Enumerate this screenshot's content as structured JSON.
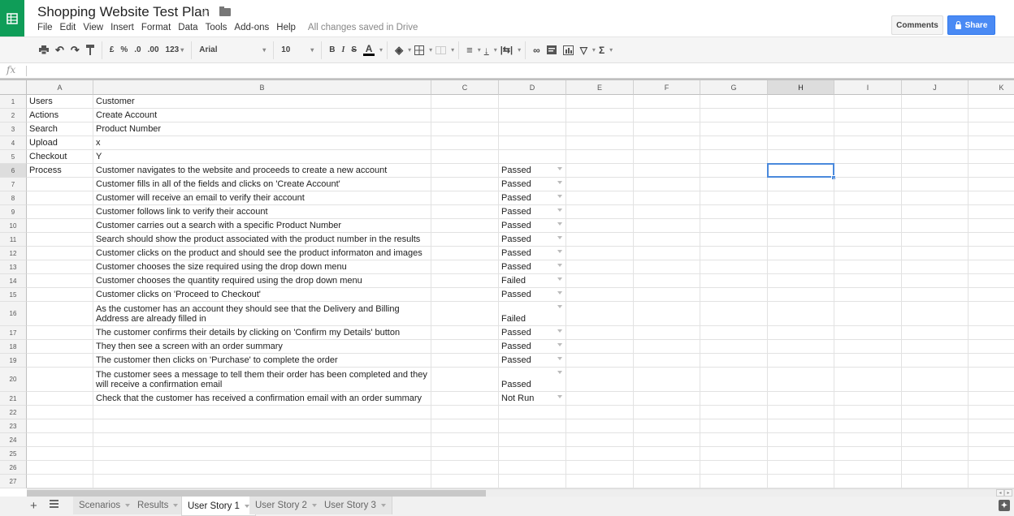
{
  "app": {
    "title": "Shopping Website Test Plan",
    "save_status": "All changes saved in Drive",
    "logo_icon": "sheets-grid-icon",
    "star_icon": "star-icon",
    "folder_icon": "folder-icon"
  },
  "menu": [
    "File",
    "Edit",
    "View",
    "Insert",
    "Format",
    "Data",
    "Tools",
    "Add-ons",
    "Help"
  ],
  "header_buttons": {
    "comments": "Comments",
    "share": "Share"
  },
  "toolbar": {
    "currency": "£",
    "percent": "%",
    "decrease_decimals": ".0",
    "increase_decimals": ".00",
    "more_formats": "123",
    "font": "Arial",
    "font_size": "10",
    "bold": "B",
    "italic": "I",
    "strikethrough": "S",
    "text_color": "A",
    "sum": "Σ"
  },
  "formula_bar": {
    "fx": "fx",
    "value": ""
  },
  "columns": [
    "A",
    "B",
    "C",
    "D",
    "E",
    "F",
    "G",
    "H",
    "I",
    "J",
    "K"
  ],
  "selected_cell": "H6",
  "rows": [
    {
      "n": "1",
      "a": "Users",
      "b": "Customer",
      "d": ""
    },
    {
      "n": "2",
      "a": "Actions",
      "b": "Create Account",
      "d": ""
    },
    {
      "n": "3",
      "a": "Search",
      "b": "Product Number",
      "d": ""
    },
    {
      "n": "4",
      "a": "Upload",
      "b": "x",
      "d": ""
    },
    {
      "n": "5",
      "a": "Checkout",
      "b": "Y",
      "d": ""
    },
    {
      "n": "6",
      "a": "Process",
      "b": "Customer navigates to the website and proceeds to create a new account",
      "d": "Passed"
    },
    {
      "n": "7",
      "a": "",
      "b": "Customer fills in all of the fields and clicks on 'Create Account'",
      "d": "Passed"
    },
    {
      "n": "8",
      "a": "",
      "b": "Customer will receive an email to verify their account",
      "d": "Passed"
    },
    {
      "n": "9",
      "a": "",
      "b": "Customer follows link to verify their account",
      "d": "Passed"
    },
    {
      "n": "10",
      "a": "",
      "b": "Customer carries out a search with a specific Product Number",
      "d": "Passed"
    },
    {
      "n": "11",
      "a": "",
      "b": "Search should show the product associated with the product number in the results",
      "d": "Passed"
    },
    {
      "n": "12",
      "a": "",
      "b": "Customer clicks on the product and should see the product informaton and images",
      "d": "Passed"
    },
    {
      "n": "13",
      "a": "",
      "b": "Customer chooses the size required using the drop down menu",
      "d": "Passed"
    },
    {
      "n": "14",
      "a": "",
      "b": "Customer chooses the quantity required using the drop down menu",
      "d": "Failed"
    },
    {
      "n": "15",
      "a": "",
      "b": "Customer clicks on 'Proceed to Checkout'",
      "d": "Passed"
    },
    {
      "n": "16",
      "a": "",
      "b": "As the customer has an account they should see that the Delivery and Billing Address are already filled in",
      "d": "Failed"
    },
    {
      "n": "17",
      "a": "",
      "b": "The customer confirms their details by clicking on 'Confirm my Details' button",
      "d": "Passed"
    },
    {
      "n": "18",
      "a": "",
      "b": "They then see a screen with an order summary",
      "d": "Passed"
    },
    {
      "n": "19",
      "a": "",
      "b": "The customer then clicks on 'Purchase' to complete the order",
      "d": "Passed"
    },
    {
      "n": "20",
      "a": "",
      "b": "The customer sees a message to tell them their order has been completed and they will receive a confirmation email",
      "d": "Passed"
    },
    {
      "n": "21",
      "a": "",
      "b": "Check that the customer has received a confirmation email with an order summary",
      "d": "Not Run"
    },
    {
      "n": "22",
      "a": "",
      "b": "",
      "d": ""
    },
    {
      "n": "23",
      "a": "",
      "b": "",
      "d": ""
    },
    {
      "n": "24",
      "a": "",
      "b": "",
      "d": ""
    },
    {
      "n": "25",
      "a": "",
      "b": "",
      "d": ""
    },
    {
      "n": "26",
      "a": "",
      "b": "",
      "d": ""
    },
    {
      "n": "27",
      "a": "",
      "b": "",
      "d": ""
    }
  ],
  "sheet_tabs": [
    {
      "label": "Scenarios",
      "active": false
    },
    {
      "label": "Results",
      "active": false
    },
    {
      "label": "User Story 1",
      "active": true
    },
    {
      "label": "User Story 2",
      "active": false
    },
    {
      "label": "User Story 3",
      "active": false
    }
  ],
  "bottom": {
    "add_sheet": "+",
    "explore_icon": "explore-icon"
  }
}
